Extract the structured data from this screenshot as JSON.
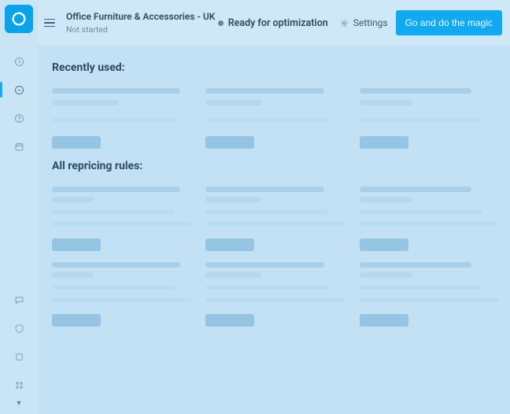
{
  "rail": {
    "items": [
      {
        "name": "clock-icon"
      },
      {
        "name": "rules-icon",
        "active": true
      },
      {
        "name": "help-icon"
      },
      {
        "name": "calendar-icon"
      }
    ],
    "bottom": [
      {
        "name": "chat-icon"
      },
      {
        "name": "shield-icon"
      },
      {
        "name": "box-icon"
      },
      {
        "name": "grid-icon"
      }
    ]
  },
  "header": {
    "title": "Office Furniture & Accessories - UK",
    "subtitle": "Not started",
    "status": "Ready for optimization",
    "settings_label": "Settings",
    "cta_label": "Go and do the magic"
  },
  "sections": {
    "recent_title": "Recently used:",
    "all_title": "All repricing rules:"
  }
}
